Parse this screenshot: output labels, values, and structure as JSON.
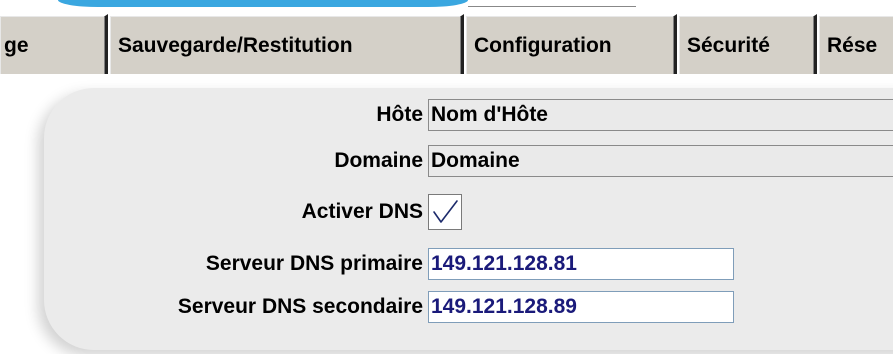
{
  "tabs": [
    {
      "label": "ge"
    },
    {
      "label": "Sauvegarde/Restitution"
    },
    {
      "label": "Configuration"
    },
    {
      "label": "Sécurité"
    },
    {
      "label": "Rése"
    }
  ],
  "form": {
    "host_label": "Hôte",
    "host_value": "Nom d'Hôte",
    "domain_label": "Domaine",
    "domain_value": "Domaine",
    "dns_enable_label": "Activer DNS",
    "dns_enabled": true,
    "dns_primary_label": "Serveur DNS primaire",
    "dns_primary_value": "149.121.128.81",
    "dns_secondary_label": "Serveur DNS secondaire",
    "dns_secondary_value": "149.121.128.89"
  },
  "colors": {
    "accent": "#3aa7e0",
    "tab_face": "#d4d0c8",
    "panel": "#ebebeb",
    "input_text": "#1a1a7a"
  },
  "icons": {
    "checkbox_mark": "checkmark-icon"
  }
}
